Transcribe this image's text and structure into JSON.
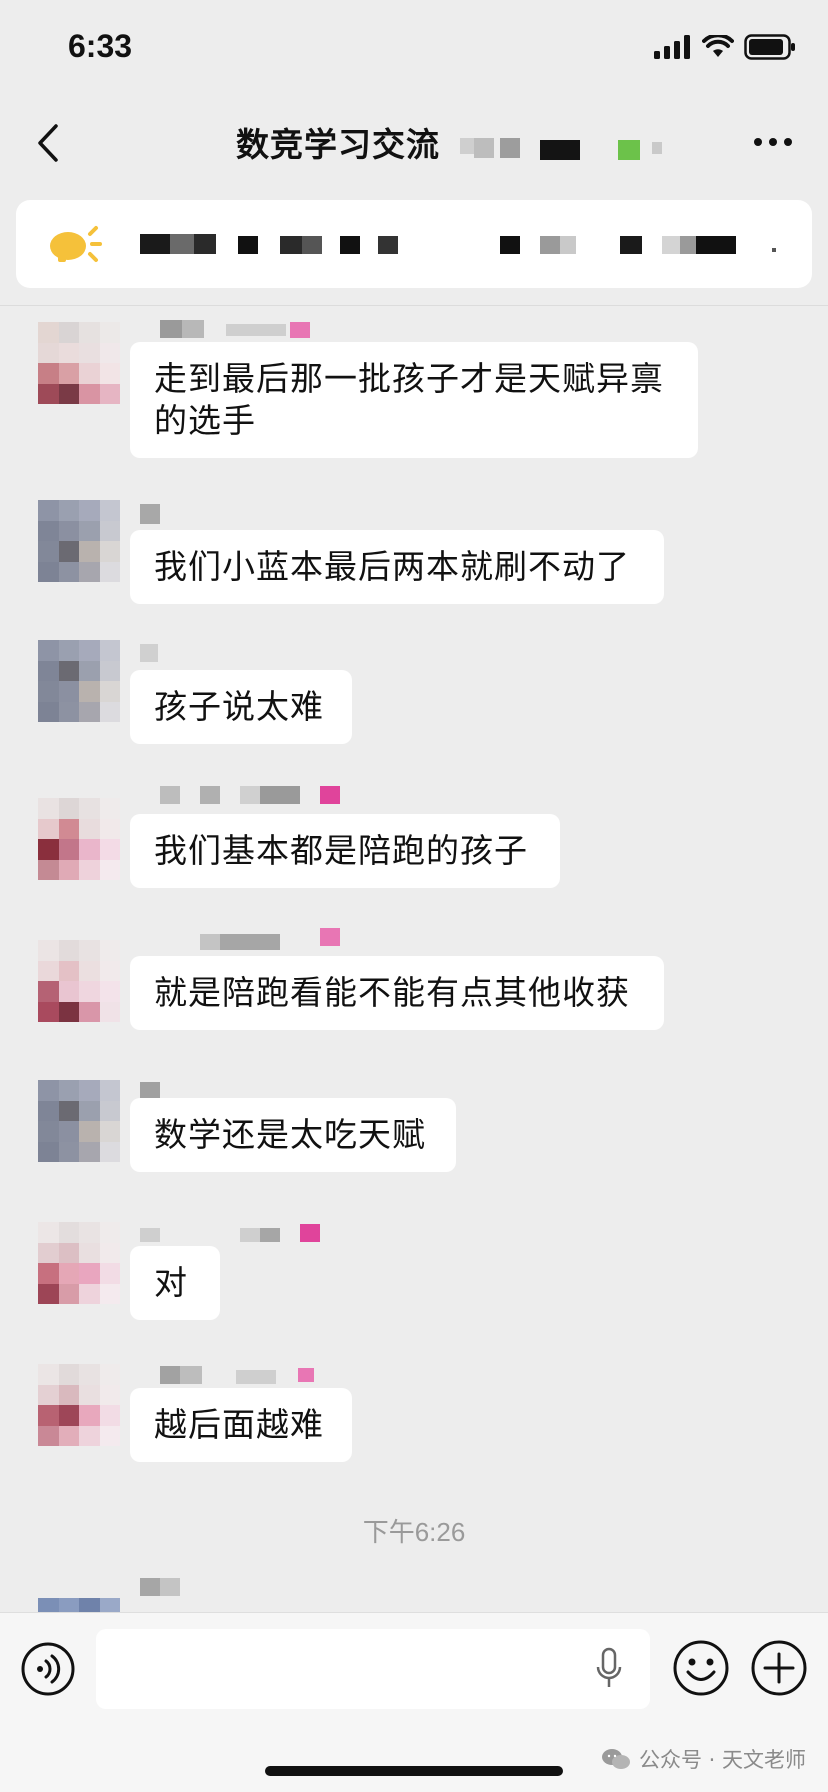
{
  "status_bar": {
    "time": "6:33"
  },
  "nav": {
    "title": "数竞学习交流"
  },
  "messages": [
    {
      "text_lines": [
        "走到最后那一批孩子才是天赋异禀",
        "的选手"
      ]
    },
    {
      "text_lines": [
        "我们小蓝本最后两本就刷不动了"
      ]
    },
    {
      "text_lines": [
        "孩子说太难"
      ]
    },
    {
      "text_lines": [
        "我们基本都是陪跑的孩子"
      ]
    },
    {
      "text_lines": [
        "就是陪跑看能不能有点其他收获"
      ]
    },
    {
      "text_lines": [
        "数学还是太吃天赋"
      ]
    },
    {
      "text_lines": [
        "对"
      ]
    },
    {
      "text_lines": [
        "越后面越难"
      ]
    }
  ],
  "timestamp": "下午6:26",
  "watermark": {
    "text": "公众号 · 天文老师"
  },
  "colors": {
    "background": "#ededed",
    "bubble": "#ffffff",
    "announcement_icon": "#f5c13a",
    "pink_tag": "#e0449b"
  }
}
